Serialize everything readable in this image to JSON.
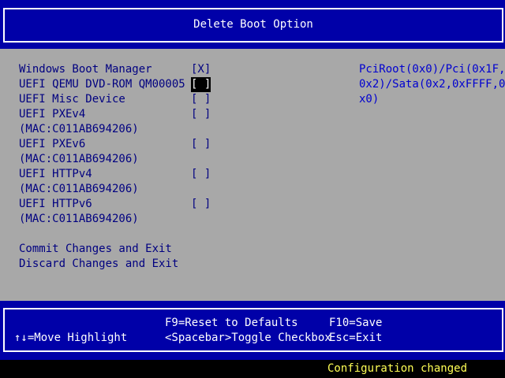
{
  "header": {
    "title": "Delete Boot Option"
  },
  "boot_options": [
    {
      "line1": "Windows Boot Manager",
      "line2": "",
      "checkbox": "[X]"
    },
    {
      "line1": "UEFI QEMU DVD-ROM QM00005",
      "line2": "",
      "checkbox": "[ ]"
    },
    {
      "line1": "UEFI Misc Device",
      "line2": "",
      "checkbox": "[ ]"
    },
    {
      "line1": "UEFI PXEv4",
      "line2": "(MAC:C011AB694206)",
      "checkbox": "[ ]"
    },
    {
      "line1": "UEFI PXEv6",
      "line2": "(MAC:C011AB694206)",
      "checkbox": "[ ]"
    },
    {
      "line1": "UEFI HTTPv4",
      "line2": "(MAC:C011AB694206)",
      "checkbox": "[ ]"
    },
    {
      "line1": "UEFI HTTPv6",
      "line2": "(MAC:C011AB694206)",
      "checkbox": "[ ]"
    }
  ],
  "actions": {
    "commit": "Commit Changes and Exit",
    "discard": "Discard Changes and Exit"
  },
  "help_text": [
    "PciRoot(0x0)/Pci(0x1F,",
    "0x2)/Sata(0x2,0xFFFF,0",
    "x0)"
  ],
  "footer": {
    "move": "↑↓=Move Highlight",
    "reset": "F9=Reset to Defaults",
    "toggle": "<Spacebar>Toggle Checkbox",
    "save": "F10=Save",
    "exit": "Esc=Exit"
  },
  "status": "Configuration changed",
  "colors": {
    "blue_bar": "#0000a8",
    "body_bg": "#a8a8a8",
    "item_text": "#000080",
    "help_text": "#0000d0",
    "status_text": "#ffff55"
  }
}
